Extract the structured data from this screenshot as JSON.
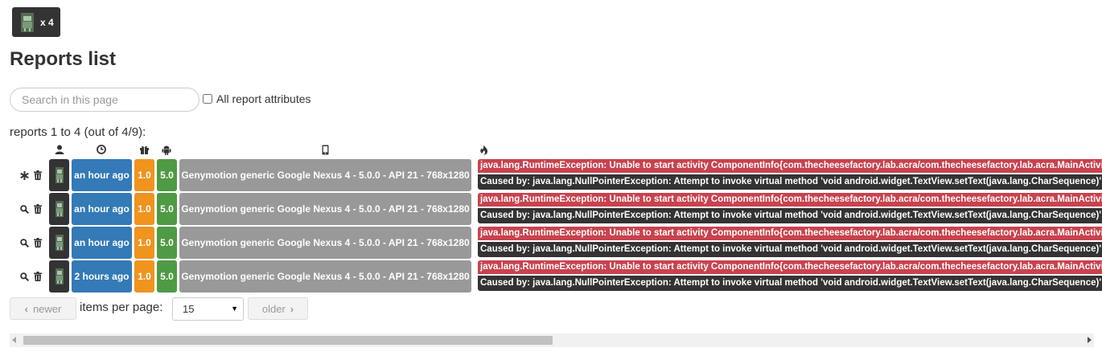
{
  "app_badge": {
    "count": "x 4",
    "icon": "android-robot-icon"
  },
  "page_title": "Reports list",
  "search": {
    "placeholder": "Search in this page",
    "value": ""
  },
  "all_attributes": {
    "label": "All report attributes",
    "checked": false
  },
  "range_text": "reports 1 to 4 (out of 4/9):",
  "columns": [
    "user-icon",
    "clock-icon",
    "gift-icon",
    "android-icon",
    "mobile-phone-icon",
    "fire-icon"
  ],
  "reports": [
    {
      "action_icon": "asterisk-icon",
      "date": "an hour ago",
      "app_version": "1.0",
      "android_version": "5.0",
      "device": "Genymotion generic Google Nexus 4 - 5.0.0 - API 21 - 768x1280",
      "exception": "java.lang.RuntimeException: Unable to start activity ComponentInfo{com.thecheesefactory.lab.acra/com.thecheesefactory.lab.acra.MainActivity}",
      "cause": "Caused by: java.lang.NullPointerException: Attempt to invoke virtual method 'void android.widget.TextView.setText(java.lang.CharSequence)'"
    },
    {
      "action_icon": "search-icon",
      "date": "an hour ago",
      "app_version": "1.0",
      "android_version": "5.0",
      "device": "Genymotion generic Google Nexus 4 - 5.0.0 - API 21 - 768x1280",
      "exception": "java.lang.RuntimeException: Unable to start activity ComponentInfo{com.thecheesefactory.lab.acra/com.thecheesefactory.lab.acra.MainActivity}",
      "cause": "Caused by: java.lang.NullPointerException: Attempt to invoke virtual method 'void android.widget.TextView.setText(java.lang.CharSequence)'"
    },
    {
      "action_icon": "search-icon",
      "date": "an hour ago",
      "app_version": "1.0",
      "android_version": "5.0",
      "device": "Genymotion generic Google Nexus 4 - 5.0.0 - API 21 - 768x1280",
      "exception": "java.lang.RuntimeException: Unable to start activity ComponentInfo{com.thecheesefactory.lab.acra/com.thecheesefactory.lab.acra.MainActivity}",
      "cause": "Caused by: java.lang.NullPointerException: Attempt to invoke virtual method 'void android.widget.TextView.setText(java.lang.CharSequence)'"
    },
    {
      "action_icon": "search-icon",
      "date": "2 hours ago",
      "app_version": "1.0",
      "android_version": "5.0",
      "device": "Genymotion generic Google Nexus 4 - 5.0.0 - API 21 - 768x1280",
      "exception": "java.lang.RuntimeException: Unable to start activity ComponentInfo{com.thecheesefactory.lab.acra/com.thecheesefactory.lab.acra.MainActivity}",
      "cause": "Caused by: java.lang.NullPointerException: Attempt to invoke virtual method 'void android.widget.TextView.setText(java.lang.CharSequence)'"
    }
  ],
  "pagination": {
    "newer_label": "newer",
    "older_label": "older",
    "items_per_page_label": "items per page:",
    "items_per_page_value": "15"
  },
  "colors": {
    "dark": "#333333",
    "date": "#337ab7",
    "version": "#f0931f",
    "android": "#4f9a44",
    "device": "#999999",
    "exception": "#c9424e"
  }
}
